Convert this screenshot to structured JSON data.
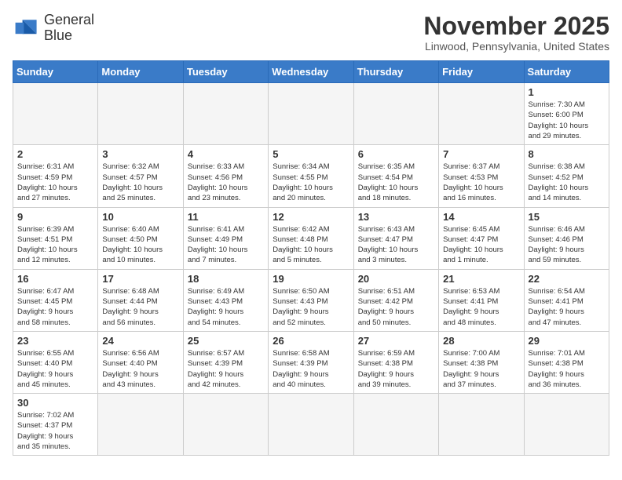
{
  "header": {
    "logo_line1": "General",
    "logo_line2": "Blue",
    "month_year": "November 2025",
    "location": "Linwood, Pennsylvania, United States"
  },
  "weekdays": [
    "Sunday",
    "Monday",
    "Tuesday",
    "Wednesday",
    "Thursday",
    "Friday",
    "Saturday"
  ],
  "weeks": [
    [
      {
        "day": "",
        "info": ""
      },
      {
        "day": "",
        "info": ""
      },
      {
        "day": "",
        "info": ""
      },
      {
        "day": "",
        "info": ""
      },
      {
        "day": "",
        "info": ""
      },
      {
        "day": "",
        "info": ""
      },
      {
        "day": "1",
        "info": "Sunrise: 7:30 AM\nSunset: 6:00 PM\nDaylight: 10 hours\nand 29 minutes."
      }
    ],
    [
      {
        "day": "2",
        "info": "Sunrise: 6:31 AM\nSunset: 4:59 PM\nDaylight: 10 hours\nand 27 minutes."
      },
      {
        "day": "3",
        "info": "Sunrise: 6:32 AM\nSunset: 4:57 PM\nDaylight: 10 hours\nand 25 minutes."
      },
      {
        "day": "4",
        "info": "Sunrise: 6:33 AM\nSunset: 4:56 PM\nDaylight: 10 hours\nand 23 minutes."
      },
      {
        "day": "5",
        "info": "Sunrise: 6:34 AM\nSunset: 4:55 PM\nDaylight: 10 hours\nand 20 minutes."
      },
      {
        "day": "6",
        "info": "Sunrise: 6:35 AM\nSunset: 4:54 PM\nDaylight: 10 hours\nand 18 minutes."
      },
      {
        "day": "7",
        "info": "Sunrise: 6:37 AM\nSunset: 4:53 PM\nDaylight: 10 hours\nand 16 minutes."
      },
      {
        "day": "8",
        "info": "Sunrise: 6:38 AM\nSunset: 4:52 PM\nDaylight: 10 hours\nand 14 minutes."
      }
    ],
    [
      {
        "day": "9",
        "info": "Sunrise: 6:39 AM\nSunset: 4:51 PM\nDaylight: 10 hours\nand 12 minutes."
      },
      {
        "day": "10",
        "info": "Sunrise: 6:40 AM\nSunset: 4:50 PM\nDaylight: 10 hours\nand 10 minutes."
      },
      {
        "day": "11",
        "info": "Sunrise: 6:41 AM\nSunset: 4:49 PM\nDaylight: 10 hours\nand 7 minutes."
      },
      {
        "day": "12",
        "info": "Sunrise: 6:42 AM\nSunset: 4:48 PM\nDaylight: 10 hours\nand 5 minutes."
      },
      {
        "day": "13",
        "info": "Sunrise: 6:43 AM\nSunset: 4:47 PM\nDaylight: 10 hours\nand 3 minutes."
      },
      {
        "day": "14",
        "info": "Sunrise: 6:45 AM\nSunset: 4:47 PM\nDaylight: 10 hours\nand 1 minute."
      },
      {
        "day": "15",
        "info": "Sunrise: 6:46 AM\nSunset: 4:46 PM\nDaylight: 9 hours\nand 59 minutes."
      }
    ],
    [
      {
        "day": "16",
        "info": "Sunrise: 6:47 AM\nSunset: 4:45 PM\nDaylight: 9 hours\nand 58 minutes."
      },
      {
        "day": "17",
        "info": "Sunrise: 6:48 AM\nSunset: 4:44 PM\nDaylight: 9 hours\nand 56 minutes."
      },
      {
        "day": "18",
        "info": "Sunrise: 6:49 AM\nSunset: 4:43 PM\nDaylight: 9 hours\nand 54 minutes."
      },
      {
        "day": "19",
        "info": "Sunrise: 6:50 AM\nSunset: 4:43 PM\nDaylight: 9 hours\nand 52 minutes."
      },
      {
        "day": "20",
        "info": "Sunrise: 6:51 AM\nSunset: 4:42 PM\nDaylight: 9 hours\nand 50 minutes."
      },
      {
        "day": "21",
        "info": "Sunrise: 6:53 AM\nSunset: 4:41 PM\nDaylight: 9 hours\nand 48 minutes."
      },
      {
        "day": "22",
        "info": "Sunrise: 6:54 AM\nSunset: 4:41 PM\nDaylight: 9 hours\nand 47 minutes."
      }
    ],
    [
      {
        "day": "23",
        "info": "Sunrise: 6:55 AM\nSunset: 4:40 PM\nDaylight: 9 hours\nand 45 minutes."
      },
      {
        "day": "24",
        "info": "Sunrise: 6:56 AM\nSunset: 4:40 PM\nDaylight: 9 hours\nand 43 minutes."
      },
      {
        "day": "25",
        "info": "Sunrise: 6:57 AM\nSunset: 4:39 PM\nDaylight: 9 hours\nand 42 minutes."
      },
      {
        "day": "26",
        "info": "Sunrise: 6:58 AM\nSunset: 4:39 PM\nDaylight: 9 hours\nand 40 minutes."
      },
      {
        "day": "27",
        "info": "Sunrise: 6:59 AM\nSunset: 4:38 PM\nDaylight: 9 hours\nand 39 minutes."
      },
      {
        "day": "28",
        "info": "Sunrise: 7:00 AM\nSunset: 4:38 PM\nDaylight: 9 hours\nand 37 minutes."
      },
      {
        "day": "29",
        "info": "Sunrise: 7:01 AM\nSunset: 4:38 PM\nDaylight: 9 hours\nand 36 minutes."
      }
    ],
    [
      {
        "day": "30",
        "info": "Sunrise: 7:02 AM\nSunset: 4:37 PM\nDaylight: 9 hours\nand 35 minutes."
      },
      {
        "day": "",
        "info": ""
      },
      {
        "day": "",
        "info": ""
      },
      {
        "day": "",
        "info": ""
      },
      {
        "day": "",
        "info": ""
      },
      {
        "day": "",
        "info": ""
      },
      {
        "day": "",
        "info": ""
      }
    ]
  ]
}
